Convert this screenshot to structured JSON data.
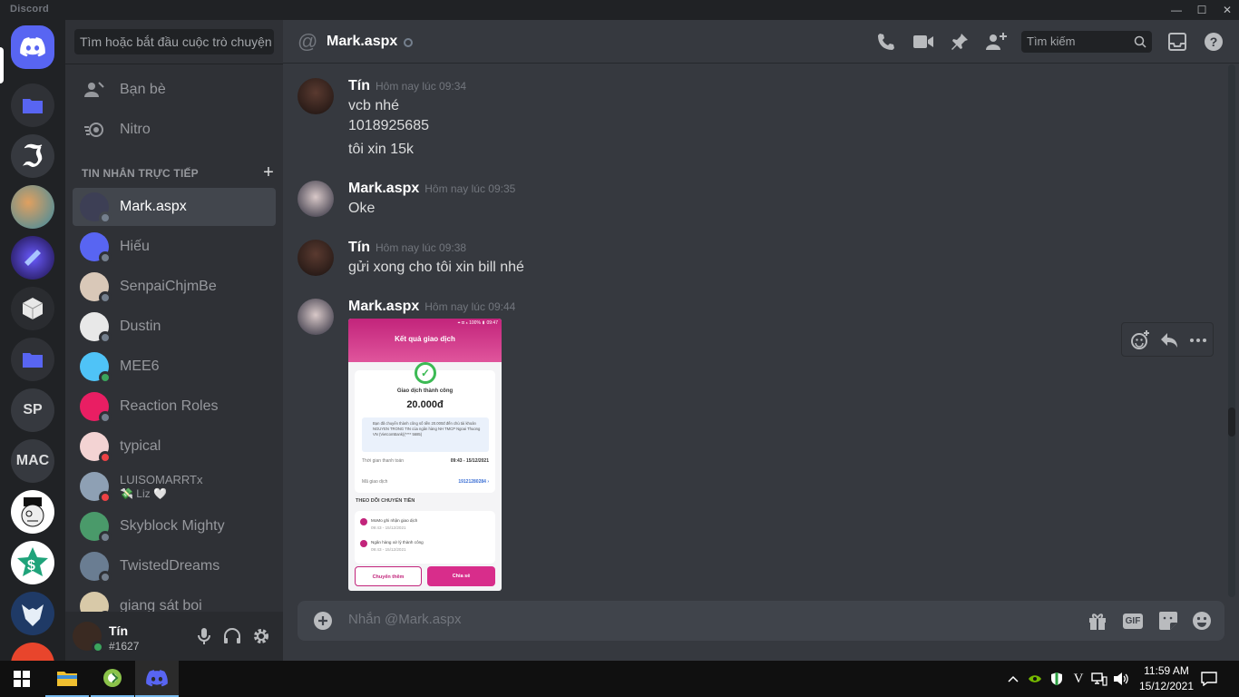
{
  "window": {
    "brand": "Discord",
    "minimize": "—",
    "maximize": "☐",
    "close": "✕"
  },
  "servers": {
    "items": [
      {
        "name": "Home",
        "label": ""
      },
      {
        "name": "Folder",
        "label": ""
      },
      {
        "name": "Server 3",
        "label": ""
      },
      {
        "name": "Server 4",
        "label": ""
      },
      {
        "name": "Server 5",
        "label": ""
      },
      {
        "name": "Server 6",
        "label": ""
      },
      {
        "name": "Folder 2",
        "label": ""
      },
      {
        "name": "SP",
        "label": "SP"
      },
      {
        "name": "MAC",
        "label": "MAC"
      }
    ]
  },
  "dm": {
    "search_placeholder": "Tìm hoặc bắt đầu cuộc trò chuyện",
    "nav": {
      "friends": "Bạn bè",
      "nitro": "Nitro"
    },
    "header": "TIN NHẮN TRỰC TIẾP",
    "add": "+",
    "list": [
      {
        "name": "Mark.aspx",
        "sub": "",
        "status": "offline",
        "color": "#3d3f55"
      },
      {
        "name": "Hiếu",
        "sub": "",
        "status": "offline",
        "color": "#5865f2"
      },
      {
        "name": "SenpaiChjmBe",
        "sub": "",
        "status": "offline",
        "color": "#d9c8b8"
      },
      {
        "name": "Dustin",
        "sub": "",
        "status": "offline",
        "color": "#e8e8e8"
      },
      {
        "name": "MEE6",
        "sub": "",
        "status": "online",
        "color": "#4fc3f7"
      },
      {
        "name": "Reaction Roles",
        "sub": "",
        "status": "offline",
        "color": "#e91e63"
      },
      {
        "name": "typical",
        "sub": "",
        "status": "dnd",
        "color": "#f3d3d3"
      },
      {
        "name": "LUISOMARRTx",
        "sub": "💸 Liz 🤍",
        "status": "dnd",
        "color": "#8ea0b4"
      },
      {
        "name": "Skyblock Mighty",
        "sub": "",
        "status": "offline",
        "color": "#4a9a6a"
      },
      {
        "name": "TwistedDreams",
        "sub": "",
        "status": "offline",
        "color": "#6a7d92"
      },
      {
        "name": "giang sát boi",
        "sub": "",
        "status": "offline",
        "color": "#d8c9a8"
      }
    ]
  },
  "user": {
    "name": "Tín",
    "tag": "#1627"
  },
  "chat": {
    "at": "@",
    "recipient": "Mark.aspx",
    "search_placeholder": "Tìm kiếm",
    "messages": [
      {
        "author": "Tín",
        "time": "Hôm nay lúc 09:34",
        "lines": [
          "vcb nhé",
          "1018925685",
          "tôi xin 15k"
        ]
      },
      {
        "author": "Mark.aspx",
        "time": "Hôm nay lúc 09:35",
        "lines": [
          "Oke"
        ]
      },
      {
        "author": "Tín",
        "time": "Hôm nay lúc 09:38",
        "lines": [
          "gửi xong cho tôi xin bill nhé"
        ]
      },
      {
        "author": "Mark.aspx",
        "time": "Hôm nay lúc 09:44",
        "lines": []
      }
    ],
    "composer_placeholder": "Nhắn @Mark.aspx",
    "gif": "GIF"
  },
  "receipt": {
    "status_bar": "⌖ ✉ ▴ 100% ▮ 09:47",
    "title": "Kết quả giao dịch",
    "success": "Giao dịch thành công",
    "amount": "20.000đ",
    "note": "Bạn đã chuyển thành công số tiền 20.000đ đến chủ tài khoản NGUYEN TRONG TIN của ngân hàng NH TMCP Ngoai Thuong VN (VietcomBank)(**** 5685)",
    "time_label": "Thời gian thanh toán",
    "time_value": "09:43 - 15/12/2021",
    "code_label": "Mã giao dịch",
    "code_value": "19121280284 ›",
    "track_title": "THEO DÕI CHUYỂN TIỀN",
    "step1": "MoMo ghi nhận giao dịch",
    "step1_time": "09:43 - 15/12/2021",
    "step2": "Ngân hàng xử lý thành công",
    "step2_time": "09:43 - 15/12/2021",
    "btn_more": "Chuyển thêm",
    "btn_share": "Chia sẻ"
  },
  "taskbar": {
    "time": "11:59 AM",
    "date": "15/12/2021"
  },
  "colors": {
    "blurple": "#5865f2",
    "bg": "#36393f",
    "sidebar": "#2f3136",
    "momo": "#c2247b"
  }
}
